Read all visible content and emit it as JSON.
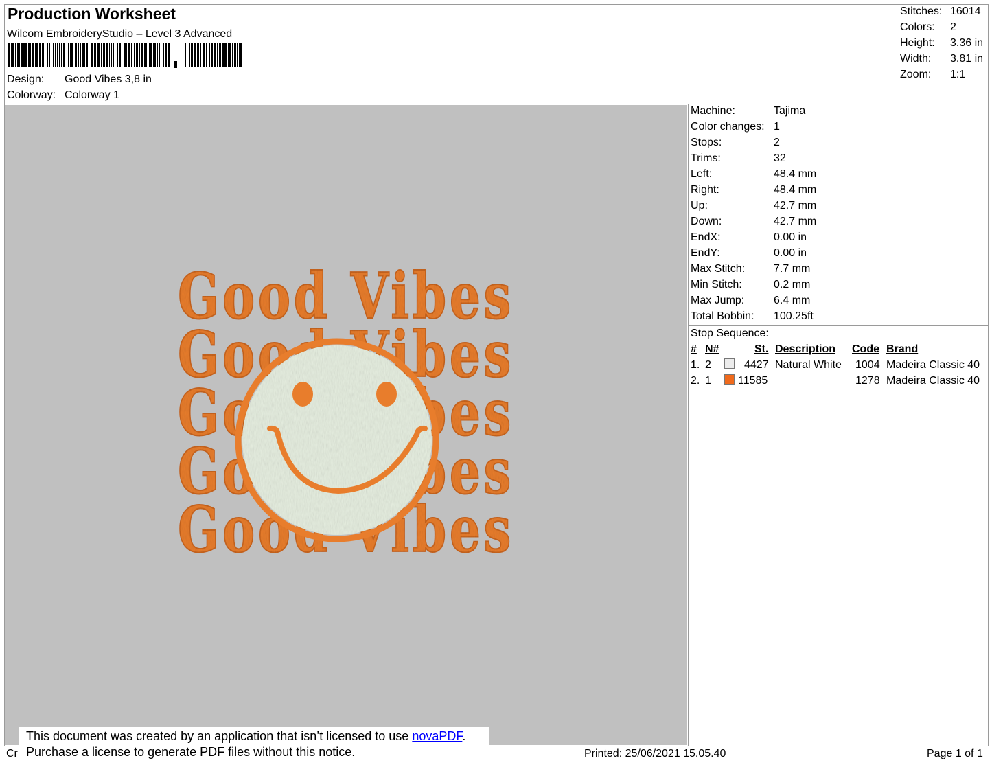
{
  "header": {
    "title": "Production Worksheet",
    "software": "Wilcom EmbroideryStudio – Level 3 Advanced",
    "design_label": "Design:",
    "design_value": "Good Vibes 3,8 in",
    "colorway_label": "Colorway:",
    "colorway_value": "Colorway 1"
  },
  "summary": [
    {
      "label": "Stitches:",
      "value": "16014"
    },
    {
      "label": "Colors:",
      "value": "2"
    },
    {
      "label": "Height:",
      "value": "3.36 in"
    },
    {
      "label": "Width:",
      "value": "3.81 in"
    },
    {
      "label": "Zoom:",
      "value": "1:1"
    }
  ],
  "details": [
    {
      "label": "Machine:",
      "value": "Tajima"
    },
    {
      "label": "Color changes:",
      "value": "1"
    },
    {
      "label": "Stops:",
      "value": "2"
    },
    {
      "label": "Trims:",
      "value": "32"
    },
    {
      "label": "Left:",
      "value": "48.4 mm"
    },
    {
      "label": "Right:",
      "value": "48.4 mm"
    },
    {
      "label": "Up:",
      "value": "42.7 mm"
    },
    {
      "label": "Down:",
      "value": "42.7 mm"
    },
    {
      "label": "EndX:",
      "value": "0.00 in"
    },
    {
      "label": "EndY:",
      "value": "0.00 in"
    },
    {
      "label": "Max Stitch:",
      "value": "7.7 mm"
    },
    {
      "label": "Min Stitch:",
      "value": "0.2 mm"
    },
    {
      "label": "Max Jump:",
      "value": "6.4 mm"
    },
    {
      "label": "Total Bobbin:",
      "value": "100.25ft"
    }
  ],
  "stop_sequence": {
    "title": "Stop Sequence:",
    "headers": {
      "num": "#",
      "n": "N#",
      "st": "St.",
      "description": "Description",
      "code": "Code",
      "brand": "Brand"
    },
    "rows": [
      {
        "num": "1.",
        "n": "2",
        "color": "#ececec",
        "st": "4427",
        "description": "Natural White",
        "code": "1004",
        "brand": "Madeira Classic 40"
      },
      {
        "num": "2.",
        "n": "1",
        "color": "#f06a1c",
        "st": "11585",
        "description": "",
        "code": "1278",
        "brand": "Madeira Classic 40"
      }
    ]
  },
  "design": {
    "text_lines": [
      "Good Vibes",
      "Good Vibes",
      "Good Vibes",
      "Good Vibes",
      "Good Vibes"
    ],
    "thread_orange": "#e87d2c",
    "thread_white": "#e6eee0",
    "background": "#c0c0c0"
  },
  "notice": {
    "line1_prefix": "This document was created by an application that isn’t licensed to use ",
    "link": "novaPDF",
    "line1_suffix": ".",
    "line2": "Purchase a license to generate PDF files without this notice."
  },
  "footer": {
    "left": "Cr",
    "printed": "Printed: 25/06/2021 15.05.40",
    "page": "Page 1 of 1"
  }
}
